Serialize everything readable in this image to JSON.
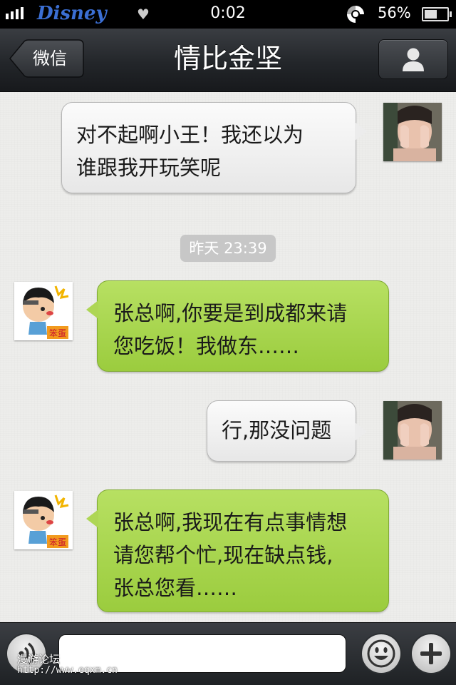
{
  "status_bar": {
    "carrier": "Disney",
    "time": "0:02",
    "battery_percent": "56%",
    "battery_level": 0.56
  },
  "nav": {
    "back_label": "微信",
    "title": "情比金坚"
  },
  "messages": [
    {
      "lines": [
        "对不起啊小王！我还以为",
        "谁跟我开玩笑呢"
      ]
    },
    {
      "lines": [
        "张总啊,你要是到成都来请",
        "您吃饭！我做东……"
      ]
    },
    {
      "lines": [
        "行,那没问题"
      ]
    },
    {
      "lines": [
        "张总啊,我现在有点事情想",
        "请您帮个忙,现在缺点钱,",
        "张总您看……"
      ]
    }
  ],
  "timestamp": "昨天 23:39",
  "avatar_badge": "笨蛋",
  "input": {
    "value": "",
    "placeholder": ""
  },
  "watermark": {
    "text": "漫游论坛",
    "url": "http://www.eqxm.cn"
  },
  "colors": {
    "outgoing_bubble": "#f3f3f3",
    "incoming_bubble": "#a8d44d",
    "nav_bar": "#2a2d31"
  }
}
